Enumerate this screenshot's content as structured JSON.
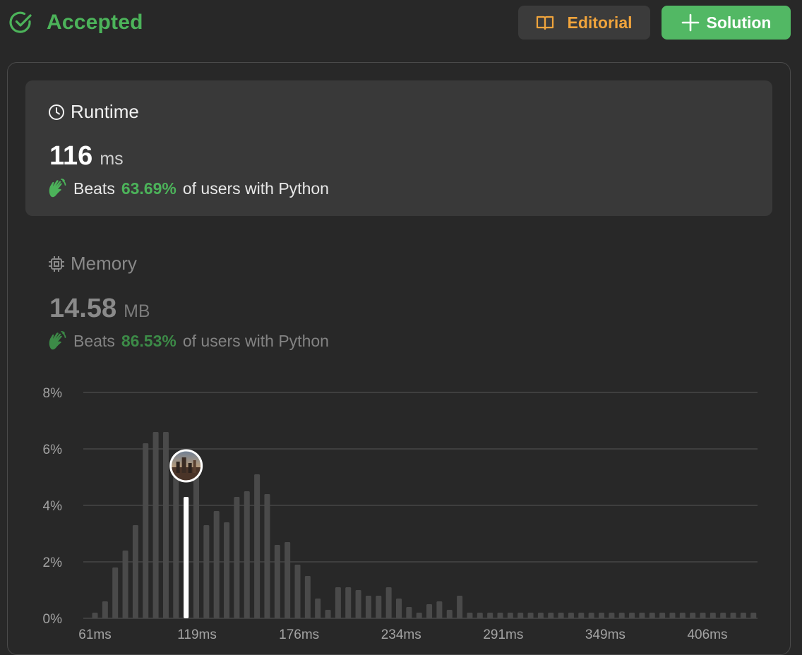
{
  "header": {
    "status": "Accepted",
    "status_icon": "check-circle-icon",
    "editorial_label": "Editorial",
    "editorial_icon": "book-icon",
    "solution_label": "Solution",
    "solution_icon": "plus-icon"
  },
  "runtime": {
    "title": "Runtime",
    "icon": "clock-icon",
    "value": "116",
    "unit": "ms",
    "beats_label": "Beats",
    "beats_pct": "63.69%",
    "beats_suffix": "of users with Python"
  },
  "memory": {
    "title": "Memory",
    "icon": "chip-icon",
    "value": "14.58",
    "unit": "MB",
    "beats_label": "Beats",
    "beats_pct": "86.53%",
    "beats_suffix": "of users with Python"
  },
  "colors": {
    "accepted": "#4cb35a",
    "editorial": "#f0a43c",
    "solution_bg": "#52b864",
    "bar": "#4a4a4a",
    "highlight_bar": "#ffffff"
  },
  "chart_data": {
    "type": "bar",
    "ylim": [
      0,
      8
    ],
    "yticks": [
      "8%",
      "6%",
      "4%",
      "2%",
      "0%"
    ],
    "xticks": [
      "61ms",
      "119ms",
      "176ms",
      "234ms",
      "291ms",
      "349ms",
      "406ms"
    ],
    "grid": true,
    "values": [
      0.2,
      0.6,
      1.8,
      2.4,
      3.3,
      6.2,
      6.6,
      6.6,
      5.8,
      4.3,
      5.6,
      3.3,
      3.8,
      3.4,
      4.3,
      4.5,
      5.1,
      4.4,
      2.6,
      2.7,
      1.9,
      1.5,
      0.7,
      0.3,
      1.1,
      1.1,
      1.0,
      0.8,
      0.8,
      1.1,
      0.7,
      0.4,
      0.2,
      0.5,
      0.6,
      0.3,
      0.8,
      0.2,
      0.2,
      0.2,
      0.2,
      0.2,
      0.2,
      0.2,
      0.2,
      0.2,
      0.2,
      0.2,
      0.2,
      0.2,
      0.2,
      0.2,
      0.2,
      0.2,
      0.2,
      0.2,
      0.2,
      0.2,
      0.2,
      0.2,
      0.2,
      0.2,
      0.2,
      0.2,
      0.2,
      0.2
    ],
    "highlight_index": 9,
    "highlight_value": 4.3,
    "highlight_marker": "avatar"
  }
}
